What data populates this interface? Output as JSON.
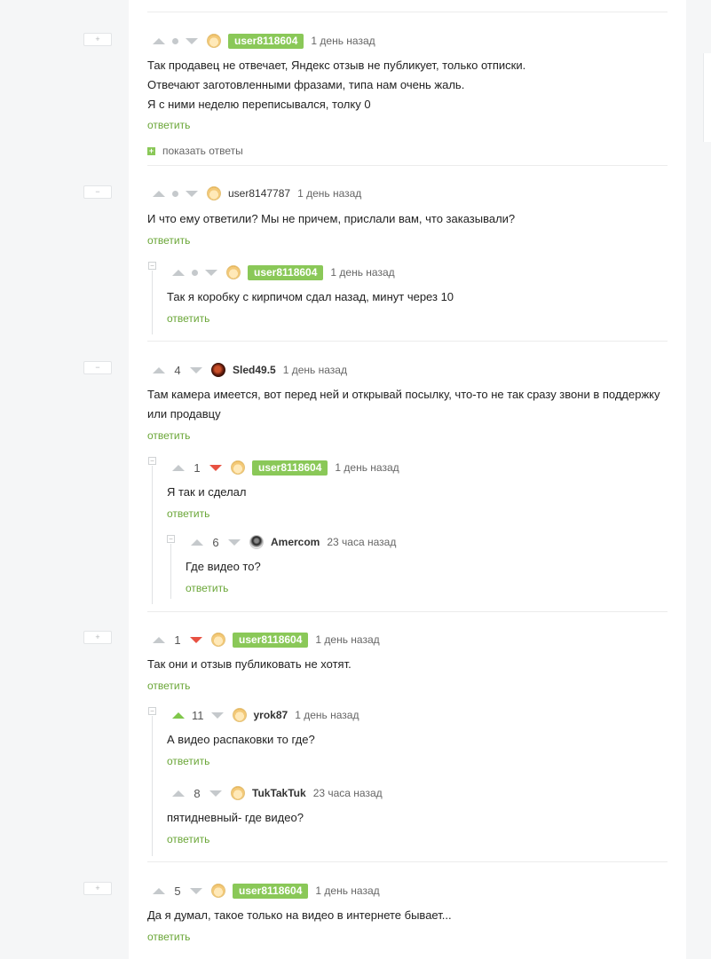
{
  "comments": [
    {
      "score": "",
      "username": "user8118604",
      "time": "1 день назад",
      "lines": [
        "Так продавец не отвечает, Яндекс отзыв не публикует, только отписки.",
        "Отвечают заготовленными фразами, типа нам очень жаль.",
        "Я с ними неделю переписывался, толку 0"
      ],
      "reply_label": "ответить",
      "show_replies_label": "показать ответы",
      "collapse_label": "+"
    },
    {
      "score": "",
      "username": "user8147787",
      "time": "1 день назад",
      "lines": [
        "И что ему ответили? Мы не причем, прислали вам, что заказывали?"
      ],
      "reply_label": "ответить",
      "collapse_label": "−",
      "children": [
        {
          "score": "",
          "username": "user8118604",
          "time": "1 день назад",
          "lines": [
            "Так я коробку с кирпичом сдал назад, минут через 10"
          ],
          "reply_label": "ответить"
        }
      ]
    },
    {
      "score": "4",
      "username": "Sled49.5",
      "time": "1 день назад",
      "lines": [
        "Там камера имеется, вот перед ней и открывай посылку, что-то не так сразу звони в поддержку",
        "или продавцу"
      ],
      "reply_label": "ответить",
      "collapse_label": "−",
      "children": [
        {
          "score": "1",
          "username": "user8118604",
          "time": "1 день назад",
          "lines": [
            "Я так и сделал"
          ],
          "reply_label": "ответить"
        },
        {
          "score": "6",
          "username": "Amercom",
          "time": "23 часа назад",
          "lines": [
            "Где видео то?"
          ],
          "reply_label": "ответить"
        }
      ]
    },
    {
      "score": "1",
      "username": "user8118604",
      "time": "1 день назад",
      "lines": [
        "Так они и отзыв публиковать не хотят."
      ],
      "reply_label": "ответить",
      "collapse_label": "+",
      "children": [
        {
          "score": "11",
          "username": "yrok87",
          "time": "1 день назад",
          "lines": [
            "А видео распаковки то где?"
          ],
          "reply_label": "ответить"
        },
        {
          "score": "8",
          "username": "TukTakTuk",
          "time": "23 часа назад",
          "lines": [
            "пятидневный- где видео?"
          ],
          "reply_label": "ответить"
        }
      ]
    },
    {
      "score": "5",
      "username": "user8118604",
      "time": "1 день назад",
      "lines": [
        "Да я думал, такое только на видео в интернете бывает..."
      ],
      "reply_label": "ответить",
      "collapse_label": "+"
    }
  ],
  "colors": {
    "badge": "#8ac858",
    "upvote": "#7fc74a",
    "downvote": "#e85142",
    "link": "#6aa637"
  }
}
